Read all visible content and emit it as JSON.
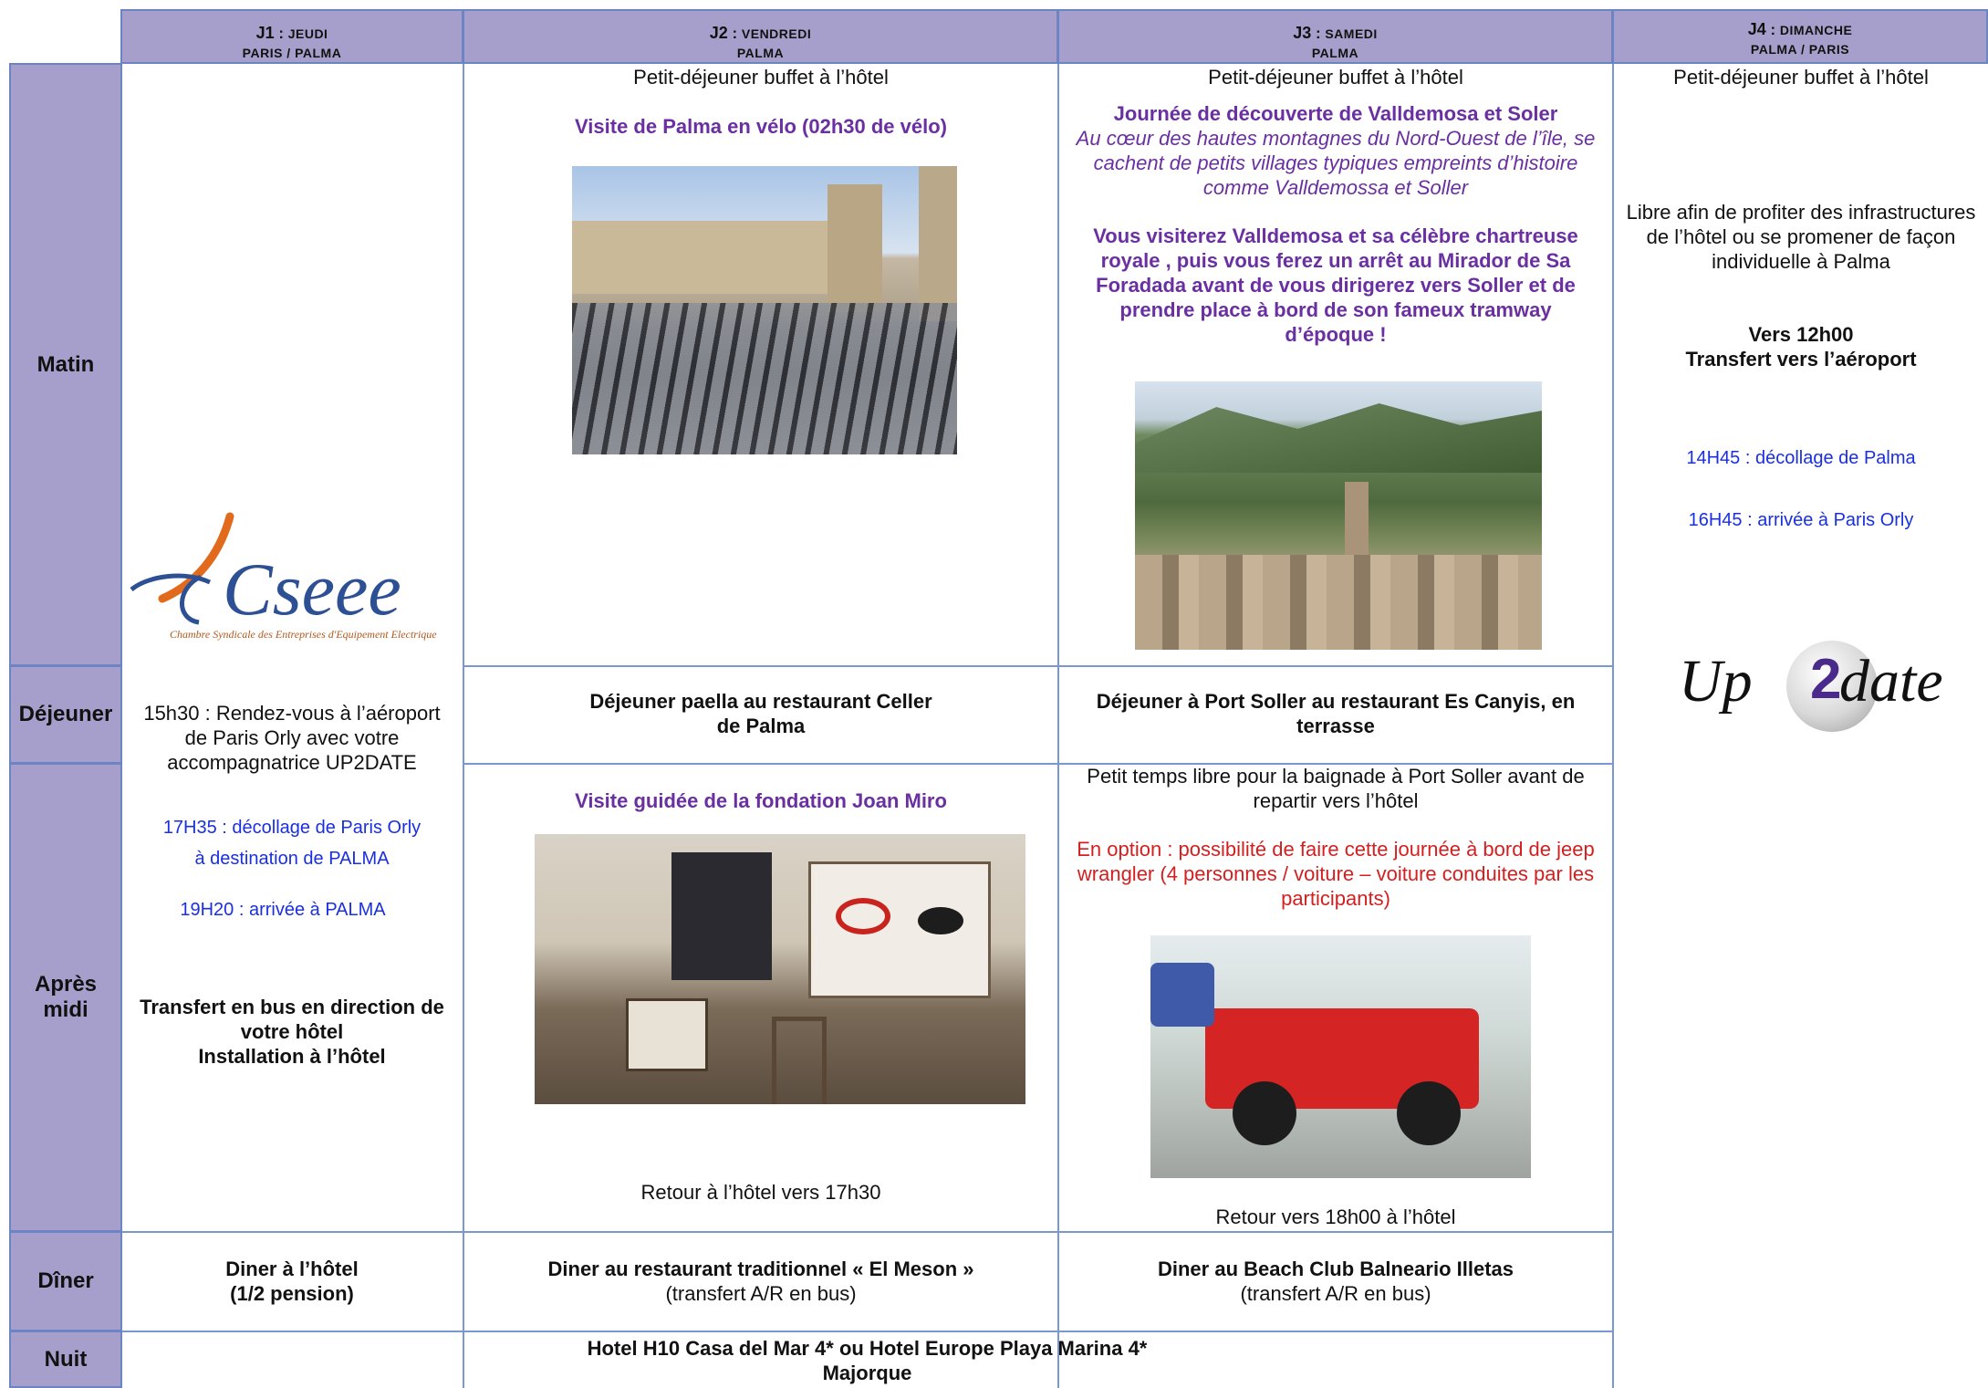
{
  "days": [
    {
      "code": "J1",
      "day": "JEUDI",
      "place": "PARIS / PALMA"
    },
    {
      "code": "J2",
      "day": "VENDREDI",
      "place": "PALMA"
    },
    {
      "code": "J3",
      "day": "SAMEDI",
      "place": "PALMA"
    },
    {
      "code": "J4",
      "day": "DIMANCHE",
      "place": "PALMA / PARIS"
    }
  ],
  "rows": {
    "matin": "Matin",
    "dejeuner": "Déjeuner",
    "apres_midi_1": "Après",
    "apres_midi_2": "midi",
    "diner": "Dîner",
    "nuit": "Nuit"
  },
  "j1": {
    "rdv_1": "15h30 : Rendez-vous à l’aéroport",
    "rdv_2": "de Paris Orly avec votre",
    "rdv_3": "accompagnatrice UP2DATE",
    "flight_1": "17H35 : décollage de Paris Orly",
    "flight_2": "à destination de PALMA",
    "arrival": "19H20 : arrivée à PALMA",
    "transfer_1": "Transfert en bus en direction de",
    "transfer_2": "votre hôtel",
    "transfer_3": "Installation à l’hôtel",
    "diner_1": "Diner à l’hôtel",
    "diner_2": "(1/2 pension)"
  },
  "j2": {
    "breakfast": "Petit-déjeuner buffet  à l’hôtel",
    "morning_title": "Visite de Palma en vélo (02h30 de vélo)",
    "lunch_1": "Déjeuner paella au restaurant Celler",
    "lunch_2": "de Palma",
    "afternoon_title": "Visite guidée de la fondation Joan Miro",
    "return": "Retour à l’hôtel vers 17h30",
    "diner_1": "Diner au restaurant traditionnel « El Meson »",
    "diner_2": "(transfert A/R en bus)"
  },
  "j3": {
    "breakfast": "Petit-déjeuner buffet à l’hôtel",
    "morning_title": "Journée de découverte de Valldemosa et Soler",
    "intro_1": "Au cœur des hautes montagnes du Nord-Ouest de l’île,  se",
    "intro_2": "cachent de petits villages typiques empreints  d’histoire",
    "intro_3": "comme Valldemossa et Soller",
    "visit_1": "Vous visiterez Valldemosa et sa célèbre chartreuse",
    "visit_2": "royale , puis vous ferez un arrêt au Mirador de Sa",
    "visit_3": "Foradada avant de vous dirigerez vers Soller et de",
    "visit_4": "prendre place à bord de son fameux tramway",
    "visit_5": "d’époque !",
    "lunch_1": "Déjeuner à Port Soller au restaurant Es Canyis, en",
    "lunch_2": "terrasse",
    "free_1": "Petit temps libre pour la baignade à Port Soller avant de",
    "free_2": "repartir vers l’hôtel",
    "option_1": "En option : possibilité de faire cette journée à bord de jeep",
    "option_2": "wrangler (4 personnes / voiture – voiture conduites par les",
    "option_3": "participants)",
    "return": "Retour vers 18h00 à l’hôtel",
    "diner_1": "Diner au Beach Club Balneario Illetas",
    "diner_2": "(transfert A/R en bus)"
  },
  "j4": {
    "breakfast": "Petit-déjeuner buffet à l’hôtel",
    "free_1": "Libre afin de profiter des infrastructures",
    "free_2": "de l’hôtel ou se promener de façon",
    "free_3": "individuelle à Palma",
    "transfer_1": "Vers 12h00",
    "transfer_2": "Transfert vers l’aéroport",
    "takeoff": "14H45 : décollage de Palma",
    "arrival": "16H45 : arrivée à Paris Orly"
  },
  "nuit": {
    "line_1": "Hotel H10 Casa del Mar 4* ou Hotel Europe Playa Marina 4*",
    "line_2": "Majorque"
  },
  "logos": {
    "cseee_name": "Cseee",
    "cseee_sub": "Chambre Syndicale des Entreprises d'Equipement Electrique",
    "up2date_a": "Up",
    "up2date_b": "2",
    "up2date_c": "date"
  },
  "colors": {
    "header_bg": "#a79fcb",
    "grid_line": "#7b97cf",
    "purple_title": "#6a2fa0",
    "blue_flight": "#1a2fe0",
    "red_option": "#d31f1f"
  }
}
